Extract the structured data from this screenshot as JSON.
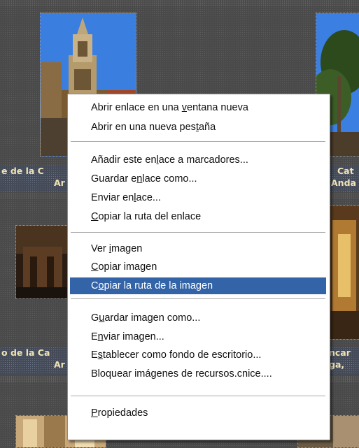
{
  "captions": {
    "row1_left_line1": "e de la C",
    "row1_left_line2": "Ar",
    "row1_right_line1": "Cat",
    "row1_right_line2": "Anda",
    "row2_left_line1": "o de la Ca",
    "row2_left_line2": "Ar",
    "row2_right_line1": "ncar",
    "row2_right_line2": "ga,"
  },
  "context_menu": {
    "items": [
      {
        "label": "Abrir enlace en una ventana nueva",
        "pre": "Abrir enlace en una ",
        "key": "v",
        "post": "entana nueva"
      },
      {
        "label": "Abrir en una nueva pestaña",
        "pre": "Abrir en una nueva pes",
        "key": "t",
        "post": "aña"
      },
      {
        "label": "Añadir este enlace a marcadores...",
        "pre": "Añadir este en",
        "key": "l",
        "post": "ace a marcadores..."
      },
      {
        "label": "Guardar enlace como...",
        "pre": "Guardar e",
        "key": "n",
        "post": "lace como..."
      },
      {
        "label": "Enviar enlace...",
        "pre": "Enviar en",
        "key": "l",
        "post": "ace..."
      },
      {
        "label": "Copiar la ruta del enlace",
        "pre": "",
        "key": "C",
        "post": "opiar la ruta del enlace"
      },
      {
        "label": "Ver imagen",
        "pre": "Ver ",
        "key": "i",
        "post": "magen"
      },
      {
        "label": "Copiar imagen",
        "pre": "",
        "key": "C",
        "post": "opiar imagen"
      },
      {
        "label": "Copiar la ruta de la imagen",
        "pre": "C",
        "key": "o",
        "post": "piar la ruta de la imagen"
      },
      {
        "label": "Guardar imagen como...",
        "pre": "G",
        "key": "u",
        "post": "ardar imagen como..."
      },
      {
        "label": "Enviar imagen...",
        "pre": "E",
        "key": "n",
        "post": "viar imagen..."
      },
      {
        "label": "Establecer como fondo de escritorio...",
        "pre": "E",
        "key": "s",
        "post": "tablecer como fondo de escritorio..."
      },
      {
        "label": "Bloquear imágenes de recursos.cnice....",
        "pre": "Bloquear imá",
        "key": "g",
        "post": "enes de recursos.cnice...."
      },
      {
        "label": "Propiedades",
        "pre": "",
        "key": "P",
        "post": "ropiedades"
      }
    ],
    "highlighted": "Copiar la ruta de la imagen",
    "highlight_color": "#3464a8"
  }
}
